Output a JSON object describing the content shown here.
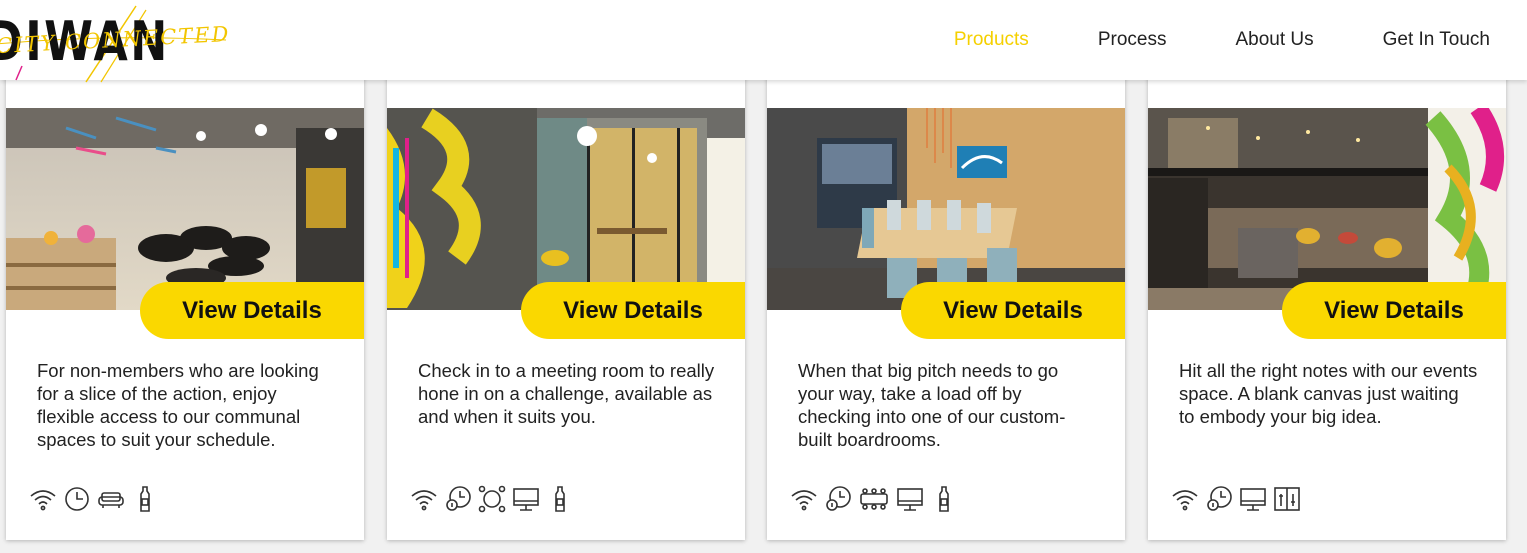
{
  "header": {
    "logo_text": "DIWAN",
    "logo_script": "CITY CONNECTED",
    "nav": [
      {
        "label": "Products",
        "active": true
      },
      {
        "label": "Process",
        "active": false
      },
      {
        "label": "About Us",
        "active": false
      },
      {
        "label": "Get In Touch",
        "active": false
      }
    ]
  },
  "colors": {
    "accent": "#fad800",
    "nav_active": "#f5d000",
    "text": "#222222",
    "graffiti_pink": "#e0208a"
  },
  "cards": [
    {
      "button": "View Details",
      "description": "For non-members who are looking for a slice of the action, enjoy flexible access to our communal spaces to suit your schedule.",
      "icons": [
        "wifi-icon",
        "clock-icon",
        "sofa-icon",
        "water-bottle-icon"
      ]
    },
    {
      "button": "View Details",
      "description": "Check in to a meeting room to really hone in on a challenge, available as and when it suits you.",
      "icons": [
        "wifi-icon",
        "hourly-clock-icon",
        "meeting-table-icon",
        "monitor-icon",
        "water-bottle-icon"
      ]
    },
    {
      "button": "View Details",
      "description": "When that big pitch needs to go your way, take a load off by checking into one of our custom-built boardrooms.",
      "icons": [
        "wifi-icon",
        "hourly-clock-icon",
        "boardroom-table-icon",
        "monitor-icon",
        "water-bottle-icon"
      ]
    },
    {
      "button": "View Details",
      "description": "Hit all the right notes with our events space. A blank canvas just waiting to embody your big idea.",
      "icons": [
        "wifi-icon",
        "hourly-clock-icon",
        "monitor-icon",
        "stage-icon"
      ]
    }
  ]
}
